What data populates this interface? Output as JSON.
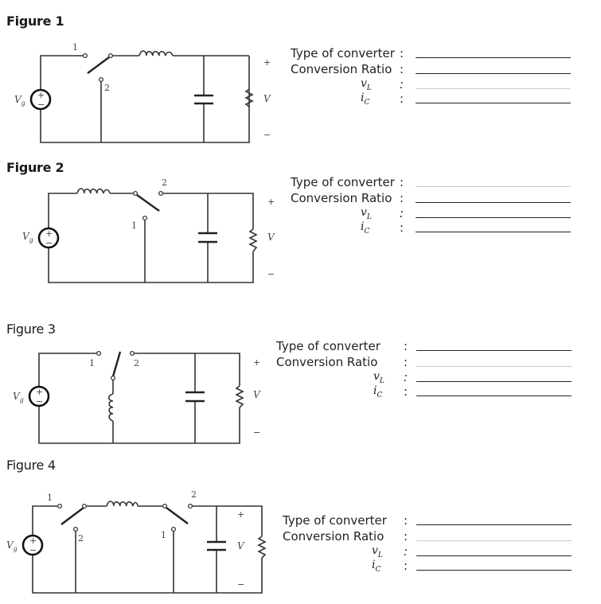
{
  "figures": [
    {
      "title": "Figure 1",
      "circuit": {
        "source": "V_g",
        "output": "V",
        "switch_terminals": [
          "1",
          "2"
        ],
        "signs": [
          "+",
          "−"
        ]
      },
      "form": {
        "type_label": "Type of converter",
        "ratio_label": "Conversion Ratio",
        "vl_label": "v",
        "vl_sub": "L",
        "ic_label": "i",
        "ic_sub": "C",
        "colon": ":",
        "colon_italic": ":"
      }
    },
    {
      "title": "Figure 2",
      "circuit": {
        "source": "V_g",
        "output": "V",
        "switch_terminals": [
          "1",
          "2"
        ],
        "signs": [
          "+",
          "−"
        ]
      },
      "form": {
        "type_label": "Type of converter",
        "ratio_label": "Conversion Ratio",
        "vl_label": "v",
        "vl_sub": "L",
        "ic_label": "i",
        "ic_sub": "C",
        "colon": ":",
        "colon_italic": ":"
      }
    },
    {
      "title": "Figure 3",
      "circuit": {
        "source": "V_g",
        "output": "V",
        "switch_terminals": [
          "1",
          "2"
        ],
        "signs": [
          "+",
          "−"
        ]
      },
      "form": {
        "type_label": "Type of converter",
        "ratio_label": "Conversion Ratio",
        "vl_label": "v",
        "vl_sub": "L",
        "ic_label": "i",
        "ic_sub": "C",
        "colon": ":",
        "colon_italic": ":"
      }
    },
    {
      "title": "Figure 4",
      "circuit": {
        "source": "V_g",
        "output": "V",
        "switch_terminals": [
          "1",
          "2",
          "1",
          "2"
        ],
        "signs": [
          "+",
          "−"
        ]
      },
      "form": {
        "type_label": "Type of converter",
        "ratio_label": "Conversion Ratio",
        "vl_label": "v",
        "vl_sub": "L",
        "ic_label": "i",
        "ic_sub": "C",
        "colon": ":",
        "colon_italic": ":"
      }
    }
  ],
  "symbols": {
    "source_main": "V",
    "source_sub": "g",
    "plus": "+",
    "minus": "−",
    "output": "V"
  }
}
